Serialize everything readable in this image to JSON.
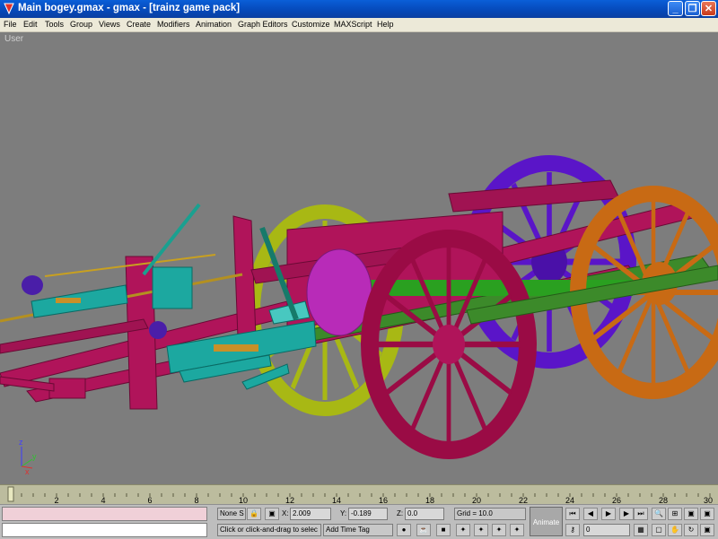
{
  "window": {
    "title": "Main bogey.gmax - gmax - [trainz game pack]",
    "minimize_glyph": "_",
    "restore_glyph": "❐",
    "close_glyph": "✕"
  },
  "menu": {
    "items": [
      "File",
      "Edit",
      "Tools",
      "Group",
      "Views",
      "Create",
      "Modifiers",
      "Animation",
      "Graph Editors",
      "Customize",
      "MAXScript",
      "Help"
    ]
  },
  "viewport": {
    "label": "User",
    "background": "#7d7d7d",
    "axis": {
      "x": "x",
      "y": "y",
      "z": "z"
    }
  },
  "timeline": {
    "ticks": [
      "2",
      "4",
      "6",
      "8",
      "10",
      "12",
      "14",
      "16",
      "18",
      "20",
      "22",
      "24",
      "26",
      "28",
      "30"
    ],
    "track_color": "#bcbc9e"
  },
  "status": {
    "selection": "None S",
    "x_label": "X:",
    "x_value": "2.009",
    "y_label": "Y:",
    "y_value": "-0.189",
    "z_label": "Z:",
    "z_value": "0.0",
    "grid": "Grid = 10.0",
    "prompt": "Click or click-and-drag to selec",
    "add_time_tag": "Add Time Tag",
    "animate": "Animate",
    "frame_value": "0"
  },
  "icons": [
    "gmax-app-icon",
    "lock-icon",
    "absolute-mode-icon",
    "key-icon",
    "play-icon",
    "zoom-icon",
    "pan-icon",
    "orbit-icon",
    "maximize-viewport-icon"
  ]
}
